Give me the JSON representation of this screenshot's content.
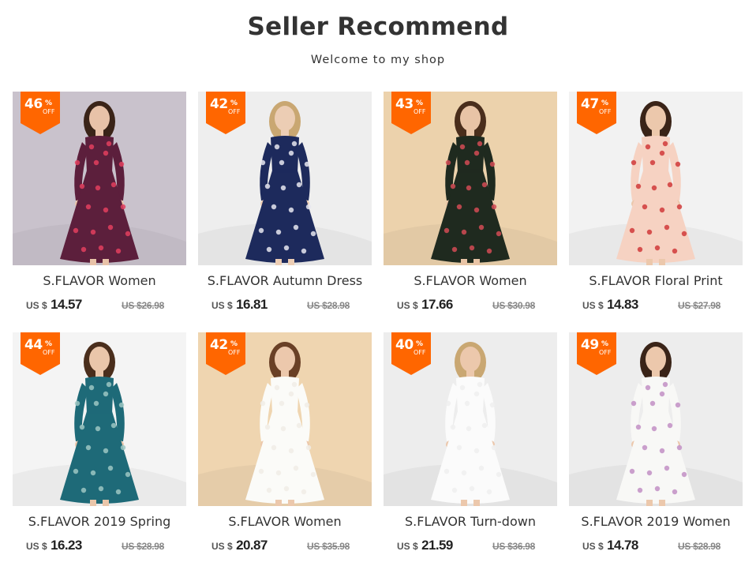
{
  "header": {
    "title": "Seller Recommend",
    "subtitle": "Welcome to my shop"
  },
  "colors": {
    "badge": "#ff6600",
    "title": "#333333",
    "old_price": "#888888"
  },
  "badge_labels": {
    "percent": "%",
    "off": "OFF"
  },
  "products": [
    {
      "discount": "46",
      "name": "S.FLAVOR Women",
      "currency": "US $",
      "price": "14.57",
      "old_price": "US $26.98",
      "bg": "#c9c2cc",
      "dress": "#5c1f3c",
      "pattern": "#e2405e",
      "skin": "#e8c2a8",
      "hair": "#3a2418"
    },
    {
      "discount": "42",
      "name": "S.FLAVOR Autumn Dress",
      "currency": "US $",
      "price": "16.81",
      "old_price": "US $28.98",
      "bg": "#eeeeee",
      "dress": "#1d2a5c",
      "pattern": "#e6e6ee",
      "skin": "#eccdb4",
      "hair": "#c9a772"
    },
    {
      "discount": "43",
      "name": "S.FLAVOR Women",
      "currency": "US $",
      "price": "17.66",
      "old_price": "US $30.98",
      "bg": "#ecd2ac",
      "dress": "#1f2a1f",
      "pattern": "#d24b55",
      "skin": "#e8c4a6",
      "hair": "#4a2e1c"
    },
    {
      "discount": "47",
      "name": "S.FLAVOR Floral Print",
      "currency": "US $",
      "price": "14.83",
      "old_price": "US $27.98",
      "bg": "#f2f2f2",
      "dress": "#f6d2c2",
      "pattern": "#d03a3a",
      "skin": "#ecc8ac",
      "hair": "#3a2418"
    },
    {
      "discount": "44",
      "name": "S.FLAVOR 2019 Spring",
      "currency": "US $",
      "price": "16.23",
      "old_price": "US $28.98",
      "bg": "#f4f4f4",
      "dress": "#1e6a78",
      "pattern": "#9cc6c2",
      "skin": "#eac6aa",
      "hair": "#4a2e1c"
    },
    {
      "discount": "42",
      "name": "S.FLAVOR Women",
      "currency": "US $",
      "price": "20.87",
      "old_price": "US $35.98",
      "bg": "#efd5b0",
      "dress": "#fbfbf8",
      "pattern": "#f0ece6",
      "skin": "#ecc8ac",
      "hair": "#6a4026"
    },
    {
      "discount": "40",
      "name": "S.FLAVOR Turn-down",
      "currency": "US $",
      "price": "21.59",
      "old_price": "US $36.98",
      "bg": "#ededed",
      "dress": "#fbfbfb",
      "pattern": "#efefef",
      "skin": "#ecc8ac",
      "hair": "#c9a772"
    },
    {
      "discount": "49",
      "name": "S.FLAVOR 2019 Women",
      "currency": "US $",
      "price": "14.78",
      "old_price": "US $28.98",
      "bg": "#ededed",
      "dress": "#f8f8f6",
      "pattern": "#c28fc4",
      "skin": "#ecc8ac",
      "hair": "#3a2418"
    }
  ]
}
